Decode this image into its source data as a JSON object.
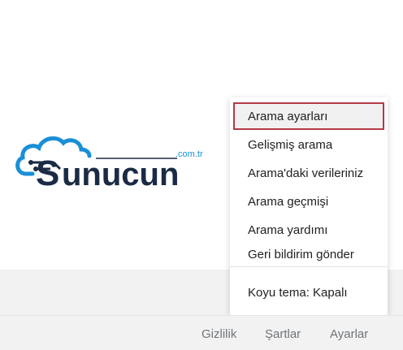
{
  "logo": {
    "text": "Sunucun",
    "tld": ".com.tr"
  },
  "menu": {
    "items": [
      {
        "label": "Arama ayarları",
        "selected": true
      },
      {
        "label": "Gelişmiş arama"
      },
      {
        "label": "Arama'daki verileriniz"
      },
      {
        "label": "Arama geçmişi"
      },
      {
        "label": "Arama yardımı"
      },
      {
        "label": "Geri bildirim gönder"
      }
    ],
    "dark_theme": "Koyu tema: Kapalı"
  },
  "footer": {
    "privacy": "Gizlilik",
    "terms": "Şartlar",
    "settings": "Ayarlar"
  },
  "colors": {
    "brand_blue": "#1a8fd6",
    "brand_dark": "#1b2b45",
    "highlight_border": "#b33a48"
  }
}
